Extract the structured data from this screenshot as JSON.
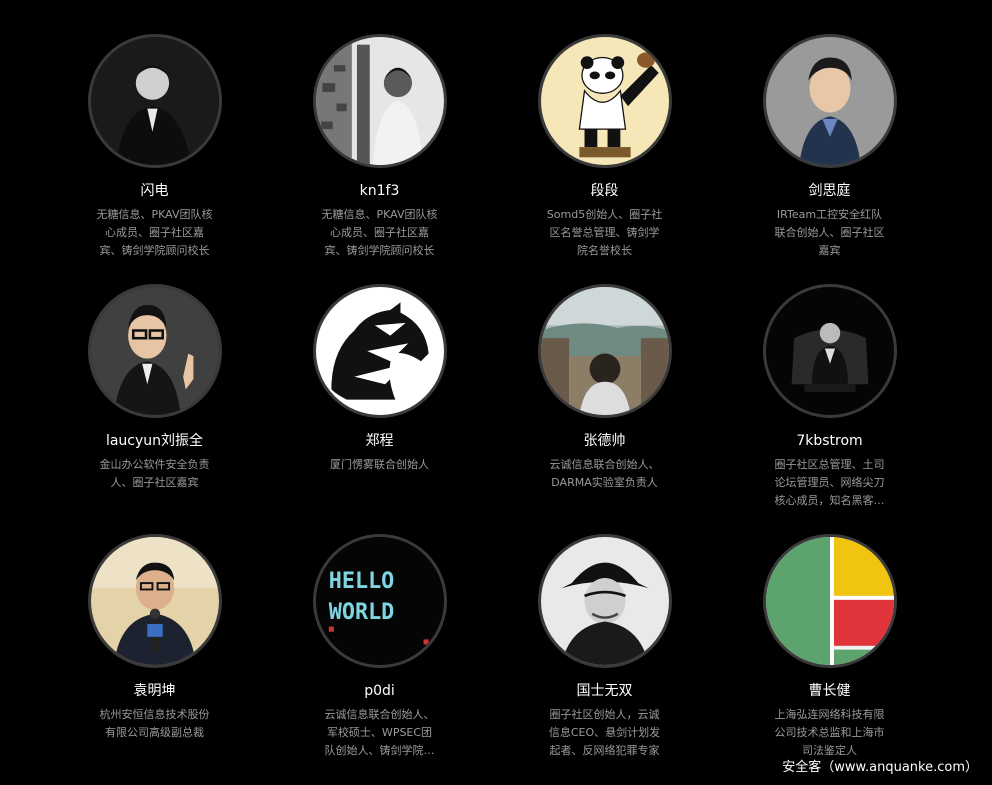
{
  "members": [
    {
      "name": "闪电",
      "desc": "无糖信息、PKAV团队核心成员、圈子社区嘉宾、铸剑学院顾问校长",
      "avatar": "portrait-bw-suit"
    },
    {
      "name": "kn1f3",
      "desc": "无糖信息、PKAV团队核心成员、圈子社区嘉宾、铸剑学院顾问校长",
      "avatar": "portrait-bw-wall"
    },
    {
      "name": "段段",
      "desc": "Somd5创始人、圈子社区名誉总管理、铸剑学院名誉校长",
      "avatar": "kungfu-panda"
    },
    {
      "name": "剑思庭",
      "desc": "IRTeam工控安全红队联合创始人、圈子社区嘉宾",
      "avatar": "portrait-young-man"
    },
    {
      "name": "laucyun刘振全",
      "desc": "金山办公软件安全负责人、圈子社区嘉宾",
      "avatar": "portrait-thumbs-up"
    },
    {
      "name": "郑程",
      "desc": "厦门愣雾联合创始人",
      "avatar": "black-knight-logo"
    },
    {
      "name": "张德帅",
      "desc": "云诚信息联合创始人、DARMA实验室负责人",
      "avatar": "landscape-back-view"
    },
    {
      "name": "7kbstrom",
      "desc": "圈子社区总管理、土司论坛管理员、网络尖刀核心成员，知名黑客、铸剑...",
      "avatar": "dark-chair-figure"
    },
    {
      "name": "袁明坤",
      "desc": "杭州安恒信息技术股份有限公司高级副总裁",
      "avatar": "portrait-microphone"
    },
    {
      "name": "p0di",
      "desc": "云诚信息联合创始人、军校硕士、WPSEC团队创始人、铸剑学院执行校长",
      "avatar": "hello-world-pixel"
    },
    {
      "name": "国士无双",
      "desc": "圈子社区创始人，云诚信息CEO、悬剑计划发起者、反网络犯罪专家",
      "avatar": "portrait-hat"
    },
    {
      "name": "曹长健",
      "desc": "上海弘连网络科技有限公司技术总监和上海市司法鉴定人",
      "avatar": "color-blocks"
    }
  ],
  "watermark": "安全客（www.anquanke.com）"
}
